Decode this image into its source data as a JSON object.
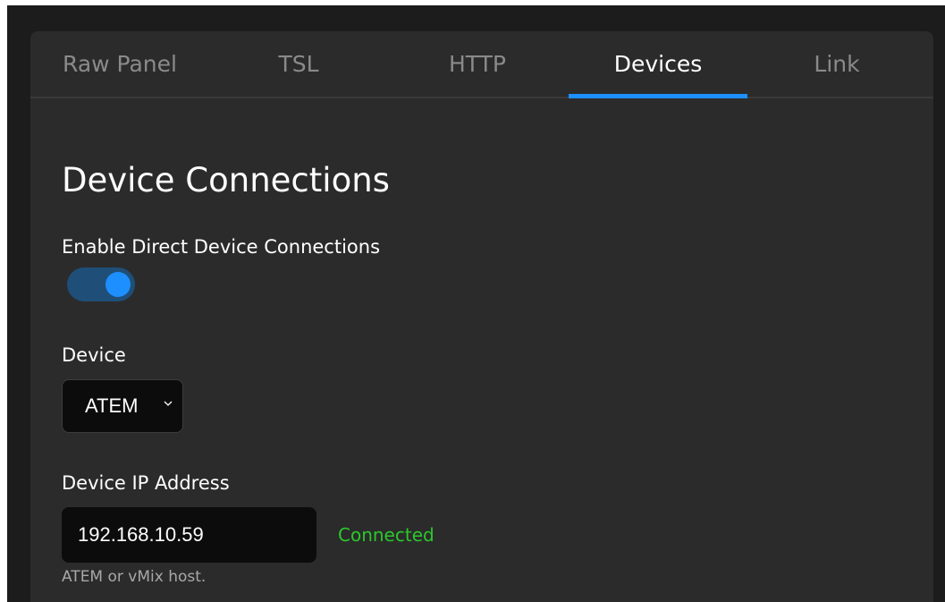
{
  "tabs": [
    {
      "label": "Raw Panel",
      "active": false
    },
    {
      "label": "TSL",
      "active": false
    },
    {
      "label": "HTTP",
      "active": false
    },
    {
      "label": "Devices",
      "active": true
    },
    {
      "label": "Link",
      "active": false
    }
  ],
  "page": {
    "title": "Device Connections"
  },
  "direct_connections": {
    "label": "Enable Direct Device Connections",
    "enabled": true
  },
  "device": {
    "label": "Device",
    "selected": "ATEM"
  },
  "ip_address": {
    "label": "Device IP Address",
    "value": "192.168.10.59",
    "status": "Connected",
    "hint": "ATEM or vMix host."
  },
  "colors": {
    "accent": "#1e8fff",
    "status_connected": "#2bc82b",
    "panel_background": "#2b2b2b"
  },
  "icons": {
    "select_chevron": "chevron-down-icon"
  }
}
